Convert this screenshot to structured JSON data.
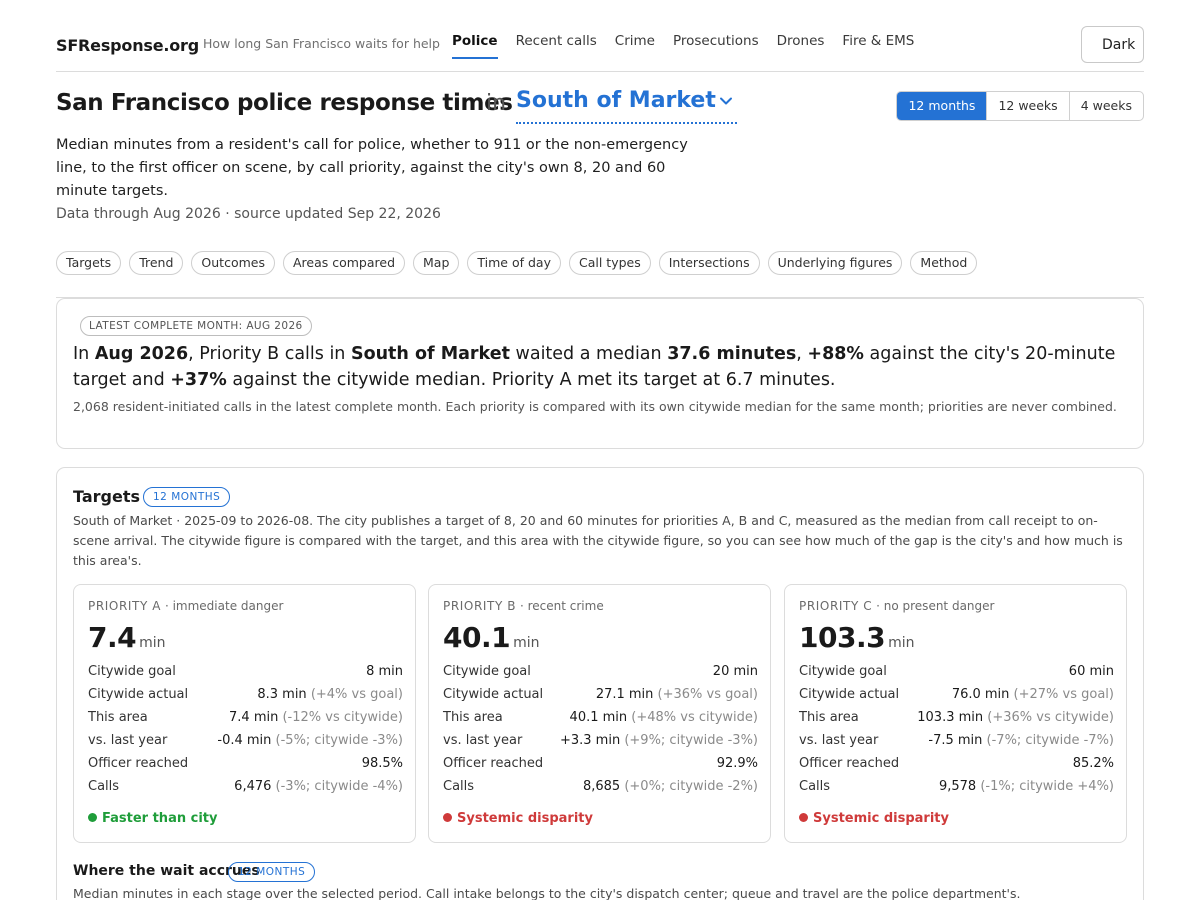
{
  "header": {
    "brand": "SFResponse.org",
    "tagline": "How long San Francisco waits for help",
    "nav": [
      "Police",
      "Recent calls",
      "Crime",
      "Prosecutions",
      "Drones",
      "Fire & EMS"
    ],
    "active_nav": "Police",
    "theme_button": "Dark"
  },
  "title": {
    "heading": "San Francisco police response times",
    "in_word": "in",
    "area": "South of Market",
    "range_options": [
      "12 months",
      "12 weeks",
      "4 weeks"
    ],
    "range_selected": "12 months"
  },
  "intro": {
    "description": "Median minutes from a resident's call for police, whether to 911 or the non-emergency line, to the first officer on scene, by call priority, against the city's own 8, 20 and 60 minute targets.",
    "updated": "Data through Aug 2026 · source updated Sep 22, 2026"
  },
  "sections": [
    "Targets",
    "Trend",
    "Outcomes",
    "Areas compared",
    "Map",
    "Time of day",
    "Call types",
    "Intersections",
    "Underlying figures",
    "Method"
  ],
  "summary": {
    "badge": "LATEST COMPLETE MONTH: AUG 2026",
    "h_1": "In ",
    "h_month": "Aug 2026",
    "h_2": ", Priority B calls in ",
    "h_area": "South of Market",
    "h_3": " waited a median ",
    "h_minutes": "37.6 minutes",
    "h_4": ", ",
    "h_vs_target": "+88%",
    "h_5": " against the city's 20-minute target and ",
    "h_vs_city": "+37%",
    "h_6": " against the citywide median. Priority A met its target at 6.7 minutes.",
    "note": "2,068 resident-initiated calls in the latest complete month. Each priority is compared with its own citywide median for the same month; priorities are never combined."
  },
  "targets": {
    "title": "Targets",
    "pill": "12 MONTHS",
    "description": "South of Market · 2025-09 to 2026-08. The city publishes a target of 8, 20 and 60 minutes for priorities A, B and C, measured as the median from call receipt to on-scene arrival. The citywide figure is compared with the target, and this area with the citywide figure, so you can see how much of the gap is the city's and how much is this area's.",
    "row_labels": [
      "Citywide goal",
      "Citywide actual",
      "This area",
      "vs. last year",
      "Officer reached",
      "Calls"
    ],
    "unit": "min",
    "priorities": [
      {
        "code": "PRIORITY A",
        "desc": "· immediate danger",
        "value": "7.4",
        "rows": [
          {
            "v": "8 min",
            "s": ""
          },
          {
            "v": "8.3 min",
            "s": "(+4% vs goal)"
          },
          {
            "v": "7.4 min",
            "s": "(-12% vs citywide)"
          },
          {
            "v": "-0.4 min",
            "s": "(-5%; citywide -3%)"
          },
          {
            "v": "98.5%",
            "s": ""
          },
          {
            "v": "6,476",
            "s": "(-3%; citywide -4%)"
          }
        ],
        "status": "Faster than city",
        "status_color": "#1f9d3a"
      },
      {
        "code": "PRIORITY B",
        "desc": "· recent crime",
        "value": "40.1",
        "rows": [
          {
            "v": "20 min",
            "s": ""
          },
          {
            "v": "27.1 min",
            "s": "(+36% vs goal)"
          },
          {
            "v": "40.1 min",
            "s": "(+48% vs citywide)"
          },
          {
            "v": "+3.3 min",
            "s": "(+9%; citywide -3%)"
          },
          {
            "v": "92.9%",
            "s": ""
          },
          {
            "v": "8,685",
            "s": "(+0%; citywide -2%)"
          }
        ],
        "status": "Systemic disparity",
        "status_color": "#cf3a3a"
      },
      {
        "code": "PRIORITY C",
        "desc": "· no present danger",
        "value": "103.3",
        "rows": [
          {
            "v": "60 min",
            "s": ""
          },
          {
            "v": "76.0 min",
            "s": "(+27% vs goal)"
          },
          {
            "v": "103.3 min",
            "s": "(+36% vs citywide)"
          },
          {
            "v": "-7.5 min",
            "s": "(-7%; citywide -7%)"
          },
          {
            "v": "85.2%",
            "s": ""
          },
          {
            "v": "9,578",
            "s": "(-1%; citywide +4%)"
          }
        ],
        "status": "Systemic disparity",
        "status_color": "#cf3a3a"
      }
    ]
  },
  "wait": {
    "title": "Where the wait accrues",
    "pill": "12 MONTHS",
    "description": "Median minutes in each stage over the selected period. Call intake belongs to the city's dispatch center; queue and travel are the police department's."
  },
  "colors": {
    "accent": "#2472d4",
    "good": "#1f9d3a",
    "bad": "#cf3a3a"
  }
}
